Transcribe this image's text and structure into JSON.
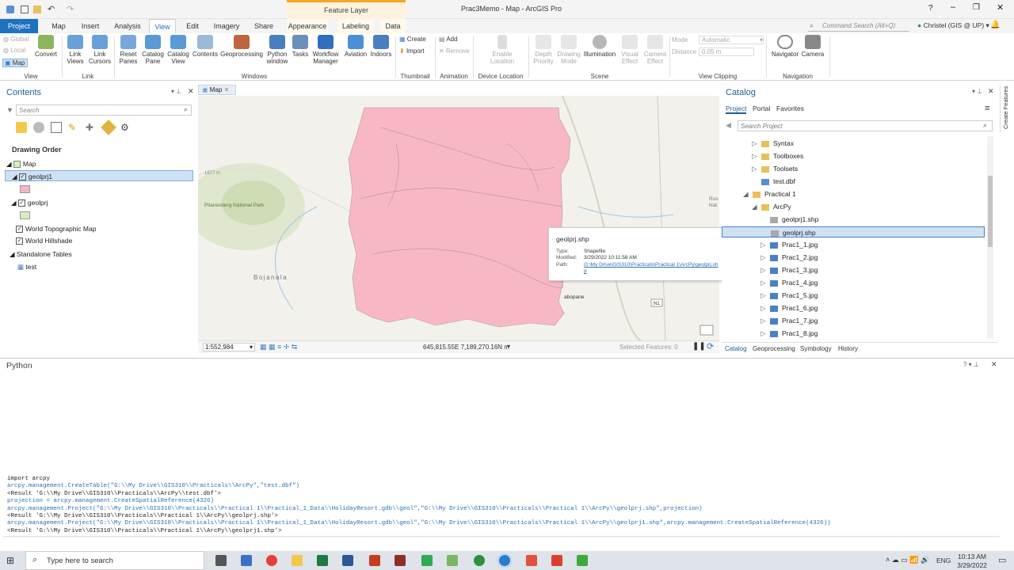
{
  "window": {
    "title": "Prac3Memo - Map - ArcGIS Pro",
    "context_tab_group": "Feature Layer",
    "command_search": "Command Search (Alt+Q)",
    "user": "Christel (GIS @ UP)"
  },
  "tabs": [
    "Project",
    "Map",
    "Insert",
    "Analysis",
    "View",
    "Edit",
    "Imagery",
    "Share",
    "Appearance",
    "Labeling",
    "Data"
  ],
  "ribbon": {
    "view_group": {
      "items": [
        "Global",
        "Local",
        "Map"
      ],
      "convert": "Convert",
      "label": "View"
    },
    "link_group": {
      "items": [
        "Link Views",
        "Link Cursors"
      ],
      "label": "Link"
    },
    "windows_group": {
      "items": [
        "Reset Panes",
        "Catalog Pane",
        "Catalog View",
        "Contents",
        "Geoprocessing",
        "Python window",
        "Tasks",
        "Workflow Manager",
        "Aviation",
        "Indoors"
      ],
      "label": "Windows"
    },
    "thumbnail_group": {
      "items": [
        "Create",
        "Import"
      ],
      "label": "Thumbnail"
    },
    "animation_group": {
      "items": [
        "Add",
        "Remove"
      ],
      "label": "Animation"
    },
    "device_group": {
      "items": [
        "Enable Location"
      ],
      "label": "Device Location"
    },
    "scene_group": {
      "items": [
        "Depth Priority",
        "Drawing Mode",
        "Illumination",
        "Visual Effect",
        "Camera Effect"
      ],
      "label": "Scene"
    },
    "clip_group": {
      "mode_label": "Mode",
      "mode_value": "Automatic",
      "distance_label": "Distance",
      "distance_value": "0.05 m",
      "label": "View Clipping"
    },
    "nav_group": {
      "items": [
        "Navigator",
        "Camera"
      ],
      "label": "Navigation"
    }
  },
  "contents": {
    "title": "Contents",
    "search_placeholder": "Search",
    "drawing_order": "Drawing Order",
    "map": "Map",
    "layer1": "geolprj1",
    "layer2": "geolprj",
    "topo": "World Topographic Map",
    "hillshade": "World Hillshade",
    "standalone": "Standalone Tables",
    "table": "test",
    "layer1_color": "#f4b6c2",
    "layer2_color": "#d6f0c2"
  },
  "map": {
    "tab": "Map",
    "scale": "1:552,984",
    "coords": "645,815.55E 7,189,270.16N m",
    "selected": "Selected Features: 0",
    "labels": {
      "pilanesberg": "Pilanesberg National Park",
      "bojanala": "Bojanala",
      "rus": "Rus",
      "nat": "Nat",
      "abopane": "abopane",
      "n1": "N1",
      "elev": "1677 m"
    },
    "polygon_fill": "#f7b8c4"
  },
  "tooltip": {
    "name": "geolprj.shp",
    "type_label": "Type:",
    "type": "Shapefile",
    "modified_label": "Modified:",
    "modified": "3/29/2022 10:11:58 AM",
    "path_label": "Path:",
    "path": "G:\\My Drive\\GIS310\\Practicals\\Practical 1\\ArcPy\\geolprj.shp"
  },
  "catalog": {
    "title": "Catalog",
    "tabs": [
      "Project",
      "Portal",
      "Favorites"
    ],
    "search_placeholder": "Search Project",
    "items": [
      {
        "label": "Syntax",
        "kind": "folder",
        "indent": 2,
        "sel": false
      },
      {
        "label": "Toolboxes",
        "kind": "folder",
        "indent": 2,
        "sel": false
      },
      {
        "label": "Toolsets",
        "kind": "folder",
        "indent": 2,
        "sel": false
      },
      {
        "label": "test.dbf",
        "kind": "table",
        "indent": 2,
        "sel": false
      },
      {
        "label": "Practical 1",
        "kind": "folder",
        "indent": 1,
        "sel": false
      },
      {
        "label": "ArcPy",
        "kind": "folder",
        "indent": 2,
        "sel": false
      },
      {
        "label": "geolprj1.shp",
        "kind": "shp",
        "indent": 3,
        "sel": false
      },
      {
        "label": "geolprj.shp",
        "kind": "shp",
        "indent": 3,
        "sel": true
      },
      {
        "label": "Prac1_1.jpg",
        "kind": "img",
        "indent": 3,
        "sel": false
      },
      {
        "label": "Prac1_2.jpg",
        "kind": "img",
        "indent": 3,
        "sel": false
      },
      {
        "label": "Prac1_3.jpg",
        "kind": "img",
        "indent": 3,
        "sel": false
      },
      {
        "label": "Prac1_4.jpg",
        "kind": "img",
        "indent": 3,
        "sel": false
      },
      {
        "label": "Prac1_5.jpg",
        "kind": "img",
        "indent": 3,
        "sel": false
      },
      {
        "label": "Prac1_6.jpg",
        "kind": "img",
        "indent": 3,
        "sel": false
      },
      {
        "label": "Prac1_7.jpg",
        "kind": "img",
        "indent": 3,
        "sel": false
      },
      {
        "label": "Prac1_8.jpg",
        "kind": "img",
        "indent": 3,
        "sel": false
      }
    ],
    "bottom_tabs": [
      "Catalog",
      "Geoprocessing",
      "Symbology",
      "History"
    ]
  },
  "side_tab": "Create Features",
  "python": {
    "title": "Python",
    "lines": [
      "import arcpy",
      "arcpy.management.CreateTable(\"G:\\\\My Drive\\\\GIS310\\\\Practicals\\\\ArcPy\",\"test.dbf\")",
      "<Result 'G:\\\\My Drive\\\\GIS310\\\\Practicals\\\\ArcPy\\\\test.dbf'>",
      "projection = arcpy.management.CreateSpatialReference(4326)",
      "arcpy.management.Project(\"G:\\\\My Drive\\\\GIS310\\\\Practicals\\\\Practical 1\\\\Practical_1_Data\\\\HolidayResort.gdb\\\\geol\",\"G:\\\\My Drive\\\\GIS310\\\\Practicals\\\\Practical 1\\\\ArcPy\\\\geolprj.shp\",projection)",
      "<Result 'G:\\\\My Drive\\\\GIS310\\\\Practicals\\\\Practical 1\\\\ArcPy\\\\geolprj.shp'>",
      "arcpy.management.Project(\"G:\\\\My Drive\\\\GIS310\\\\Practicals\\\\Practical 1\\\\Practical_1_Data\\\\HolidayResort.gdb\\\\geol\",\"G:\\\\My Drive\\\\GIS310\\\\Practicals\\\\Practical 1\\\\ArcPy\\\\geolprj1.shp\",arcpy.management.CreateSpatialReference(4326))",
      "<Result 'G:\\\\My Drive\\\\GIS310\\\\Practicals\\\\Practical 1\\\\ArcPy\\\\geolprj1.shp'>"
    ]
  },
  "taskbar": {
    "search": "Type here to search",
    "lang": "ENG",
    "time": "10:13 AM",
    "date": "3/29/2022"
  }
}
